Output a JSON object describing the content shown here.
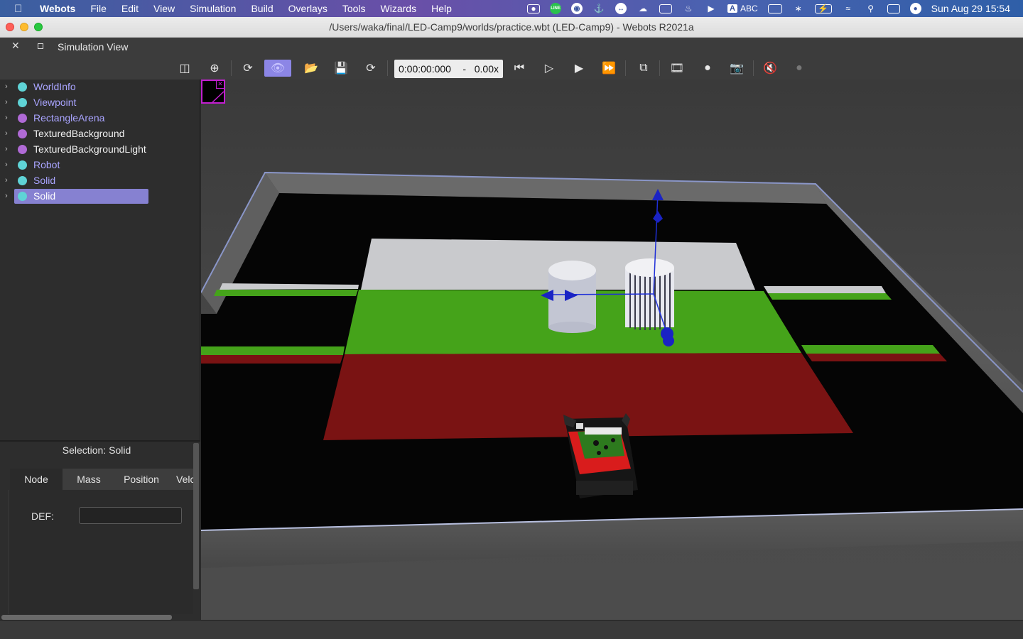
{
  "menubar": {
    "app_name": "Webots",
    "items": [
      "File",
      "Edit",
      "View",
      "Simulation",
      "Build",
      "Overlays",
      "Tools",
      "Wizards",
      "Help"
    ],
    "input_source": "ABC",
    "clock": "Sun Aug 29  15:54"
  },
  "window": {
    "title": "/Users/waka/final/LED-Camp9/worlds/practice.wbt (LED-Camp9) - Webots R2021a"
  },
  "dock": {
    "title": "Simulation View"
  },
  "toolbar": {
    "time": "0:00:00:000",
    "separator": "-",
    "speed": "0.00x",
    "active_color": "#8c86e6"
  },
  "scene_tree": {
    "items": [
      {
        "label": "WorldInfo",
        "dot_color": "#5fd3d6"
      },
      {
        "label": "Viewpoint",
        "dot_color": "#5fd3d6"
      },
      {
        "label": "RectangleArena",
        "dot_color": "#b06ad6"
      },
      {
        "label": "TexturedBackground",
        "dot_color": "#b06ad6"
      },
      {
        "label": "TexturedBackgroundLight",
        "dot_color": "#b06ad6"
      },
      {
        "label": "Robot",
        "dot_color": "#5fd3d6"
      },
      {
        "label": "Solid",
        "dot_color": "#5fd3d6"
      },
      {
        "label": "Solid",
        "dot_color": "#5fd3d6"
      }
    ],
    "selected_index": 7
  },
  "field_editor": {
    "selection_label": "Selection: Solid",
    "tabs": [
      "Node",
      "Mass",
      "Position",
      "Velc"
    ],
    "active_tab": "Node",
    "def_label": "DEF:",
    "def_value": ""
  }
}
